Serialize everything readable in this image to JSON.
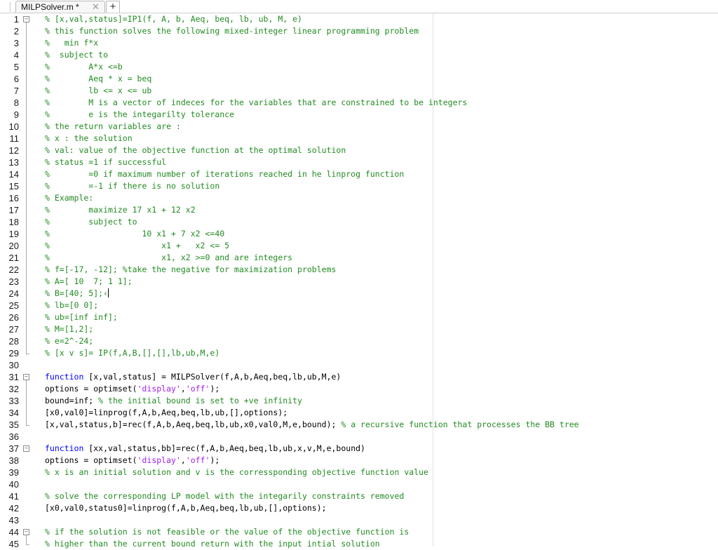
{
  "colors": {
    "comment": "#228b22",
    "keyword": "#0000ff",
    "string": "#a020f0",
    "text": "#000000"
  },
  "tabs": [
    {
      "title": "MILPSolver.m *",
      "close_glyph": "✕",
      "active": true
    }
  ],
  "tab_add_glyph": "+",
  "lines": [
    {
      "n": "1",
      "fold": "open",
      "segs": [
        {
          "t": "c",
          "v": "% [x,val,status]=IP1(f, A, b, Aeq, beq, lb, ub, M, e)"
        }
      ]
    },
    {
      "n": "2",
      "segs": [
        {
          "t": "c",
          "v": "% this function solves the following mixed-integer linear programming problem"
        }
      ]
    },
    {
      "n": "3",
      "segs": [
        {
          "t": "c",
          "v": "%   min f*x"
        }
      ]
    },
    {
      "n": "4",
      "segs": [
        {
          "t": "c",
          "v": "%  subject to"
        }
      ]
    },
    {
      "n": "5",
      "segs": [
        {
          "t": "c",
          "v": "%        A*x <=b"
        }
      ]
    },
    {
      "n": "6",
      "segs": [
        {
          "t": "c",
          "v": "%        Aeq * x = beq"
        }
      ]
    },
    {
      "n": "7",
      "segs": [
        {
          "t": "c",
          "v": "%        lb <= x <= ub"
        }
      ]
    },
    {
      "n": "8",
      "segs": [
        {
          "t": "c",
          "v": "%        M is a vector of indeces for the variables that are constrained to be integers"
        }
      ]
    },
    {
      "n": "9",
      "segs": [
        {
          "t": "c",
          "v": "%        e is the integarilty tolerance"
        }
      ]
    },
    {
      "n": "10",
      "segs": [
        {
          "t": "c",
          "v": "% the return variables are :"
        }
      ]
    },
    {
      "n": "11",
      "segs": [
        {
          "t": "c",
          "v": "% x : the solution"
        }
      ]
    },
    {
      "n": "12",
      "segs": [
        {
          "t": "c",
          "v": "% val: value of the objective function at the optimal solution"
        }
      ]
    },
    {
      "n": "13",
      "segs": [
        {
          "t": "c",
          "v": "% status =1 if successful"
        }
      ]
    },
    {
      "n": "14",
      "segs": [
        {
          "t": "c",
          "v": "%        =0 if maximum number of iterations reached in he linprog function"
        }
      ]
    },
    {
      "n": "15",
      "segs": [
        {
          "t": "c",
          "v": "%        =-1 if there is no solution"
        }
      ]
    },
    {
      "n": "16",
      "segs": [
        {
          "t": "c",
          "v": "% Example:"
        }
      ]
    },
    {
      "n": "17",
      "segs": [
        {
          "t": "c",
          "v": "%        maximize 17 x1 + 12 x2"
        }
      ]
    },
    {
      "n": "18",
      "segs": [
        {
          "t": "c",
          "v": "%        subject to"
        }
      ]
    },
    {
      "n": "19",
      "segs": [
        {
          "t": "c",
          "v": "%                   10 x1 + 7 x2 <=40"
        }
      ]
    },
    {
      "n": "20",
      "segs": [
        {
          "t": "c",
          "v": "%                       x1 +   x2 <= 5"
        }
      ]
    },
    {
      "n": "21",
      "segs": [
        {
          "t": "c",
          "v": "%                       x1, x2 >=0 and are integers"
        }
      ]
    },
    {
      "n": "22",
      "segs": [
        {
          "t": "c",
          "v": "% f=[-17, -12]; %take the negative for maximization problems"
        }
      ]
    },
    {
      "n": "23",
      "segs": [
        {
          "t": "c",
          "v": "% A=[ 10  7; 1 1];"
        }
      ]
    },
    {
      "n": "24",
      "cursor": true,
      "segs": [
        {
          "t": "c",
          "v": "% B=[40; 5];‹"
        }
      ]
    },
    {
      "n": "25",
      "segs": [
        {
          "t": "c",
          "v": "% lb=[0 0];"
        }
      ]
    },
    {
      "n": "26",
      "segs": [
        {
          "t": "c",
          "v": "% ub=[inf inf];"
        }
      ]
    },
    {
      "n": "27",
      "segs": [
        {
          "t": "c",
          "v": "% M=[1,2];"
        }
      ]
    },
    {
      "n": "28",
      "segs": [
        {
          "t": "c",
          "v": "% e=2^-24;"
        }
      ]
    },
    {
      "n": "29",
      "fold_end": true,
      "segs": [
        {
          "t": "c",
          "v": "% [x v s]= IP(f,A,B,[],[],lb,ub,M,e)"
        }
      ]
    },
    {
      "n": "30",
      "segs": []
    },
    {
      "n": "31",
      "fold": "open",
      "segs": [
        {
          "t": "k",
          "v": "function"
        },
        {
          "t": "n",
          "v": " [x,val,status] = MILPSolver(f,A,b,Aeq,beq,lb,ub,M,e)"
        }
      ]
    },
    {
      "n": "32",
      "segs": [
        {
          "t": "n",
          "v": "options = optimset("
        },
        {
          "t": "s",
          "v": "'display'"
        },
        {
          "t": "n",
          "v": ","
        },
        {
          "t": "s",
          "v": "'off'"
        },
        {
          "t": "n",
          "v": ");"
        }
      ]
    },
    {
      "n": "33",
      "segs": [
        {
          "t": "n",
          "v": "bound=inf; "
        },
        {
          "t": "c",
          "v": "% the initial bound is set to +ve infinity"
        }
      ]
    },
    {
      "n": "34",
      "segs": [
        {
          "t": "n",
          "v": "[x0,val0]=linprog(f,A,b,Aeq,beq,lb,ub,[],options);"
        }
      ]
    },
    {
      "n": "35",
      "fold_end": true,
      "segs": [
        {
          "t": "n",
          "v": "[x,val,status,b]=rec(f,A,b,Aeq,beq,lb,ub,x0,val0,M,e,bound); "
        },
        {
          "t": "c",
          "v": "% a recursive function that processes the BB tree"
        }
      ]
    },
    {
      "n": "36",
      "segs": []
    },
    {
      "n": "37",
      "fold": "open",
      "segs": [
        {
          "t": "k",
          "v": "function"
        },
        {
          "t": "n",
          "v": " [xx,val,status,bb]=rec(f,A,b,Aeq,beq,lb,ub,x,v,M,e,bound)"
        }
      ]
    },
    {
      "n": "38",
      "segs": [
        {
          "t": "n",
          "v": "options = optimset("
        },
        {
          "t": "s",
          "v": "'display'"
        },
        {
          "t": "n",
          "v": ","
        },
        {
          "t": "s",
          "v": "'off'"
        },
        {
          "t": "n",
          "v": ");"
        }
      ]
    },
    {
      "n": "39",
      "segs": [
        {
          "t": "c",
          "v": "% x is an initial solution and v is the corressponding objective function value"
        }
      ]
    },
    {
      "n": "40",
      "segs": []
    },
    {
      "n": "41",
      "segs": [
        {
          "t": "c",
          "v": "% solve the corresponding LP model with the integarily constraints removed"
        }
      ]
    },
    {
      "n": "42",
      "segs": [
        {
          "t": "n",
          "v": "[x0,val0,status0]=linprog(f,A,b,Aeq,beq,lb,ub,[],options);"
        }
      ]
    },
    {
      "n": "43",
      "segs": []
    },
    {
      "n": "44",
      "fold": "open",
      "segs": [
        {
          "t": "c",
          "v": "% if the solution is not feasible or the value of the objective function is"
        }
      ]
    },
    {
      "n": "45",
      "fold_end": true,
      "segs": [
        {
          "t": "c",
          "v": "% higher than the current bound return with the input intial solution"
        }
      ]
    }
  ]
}
